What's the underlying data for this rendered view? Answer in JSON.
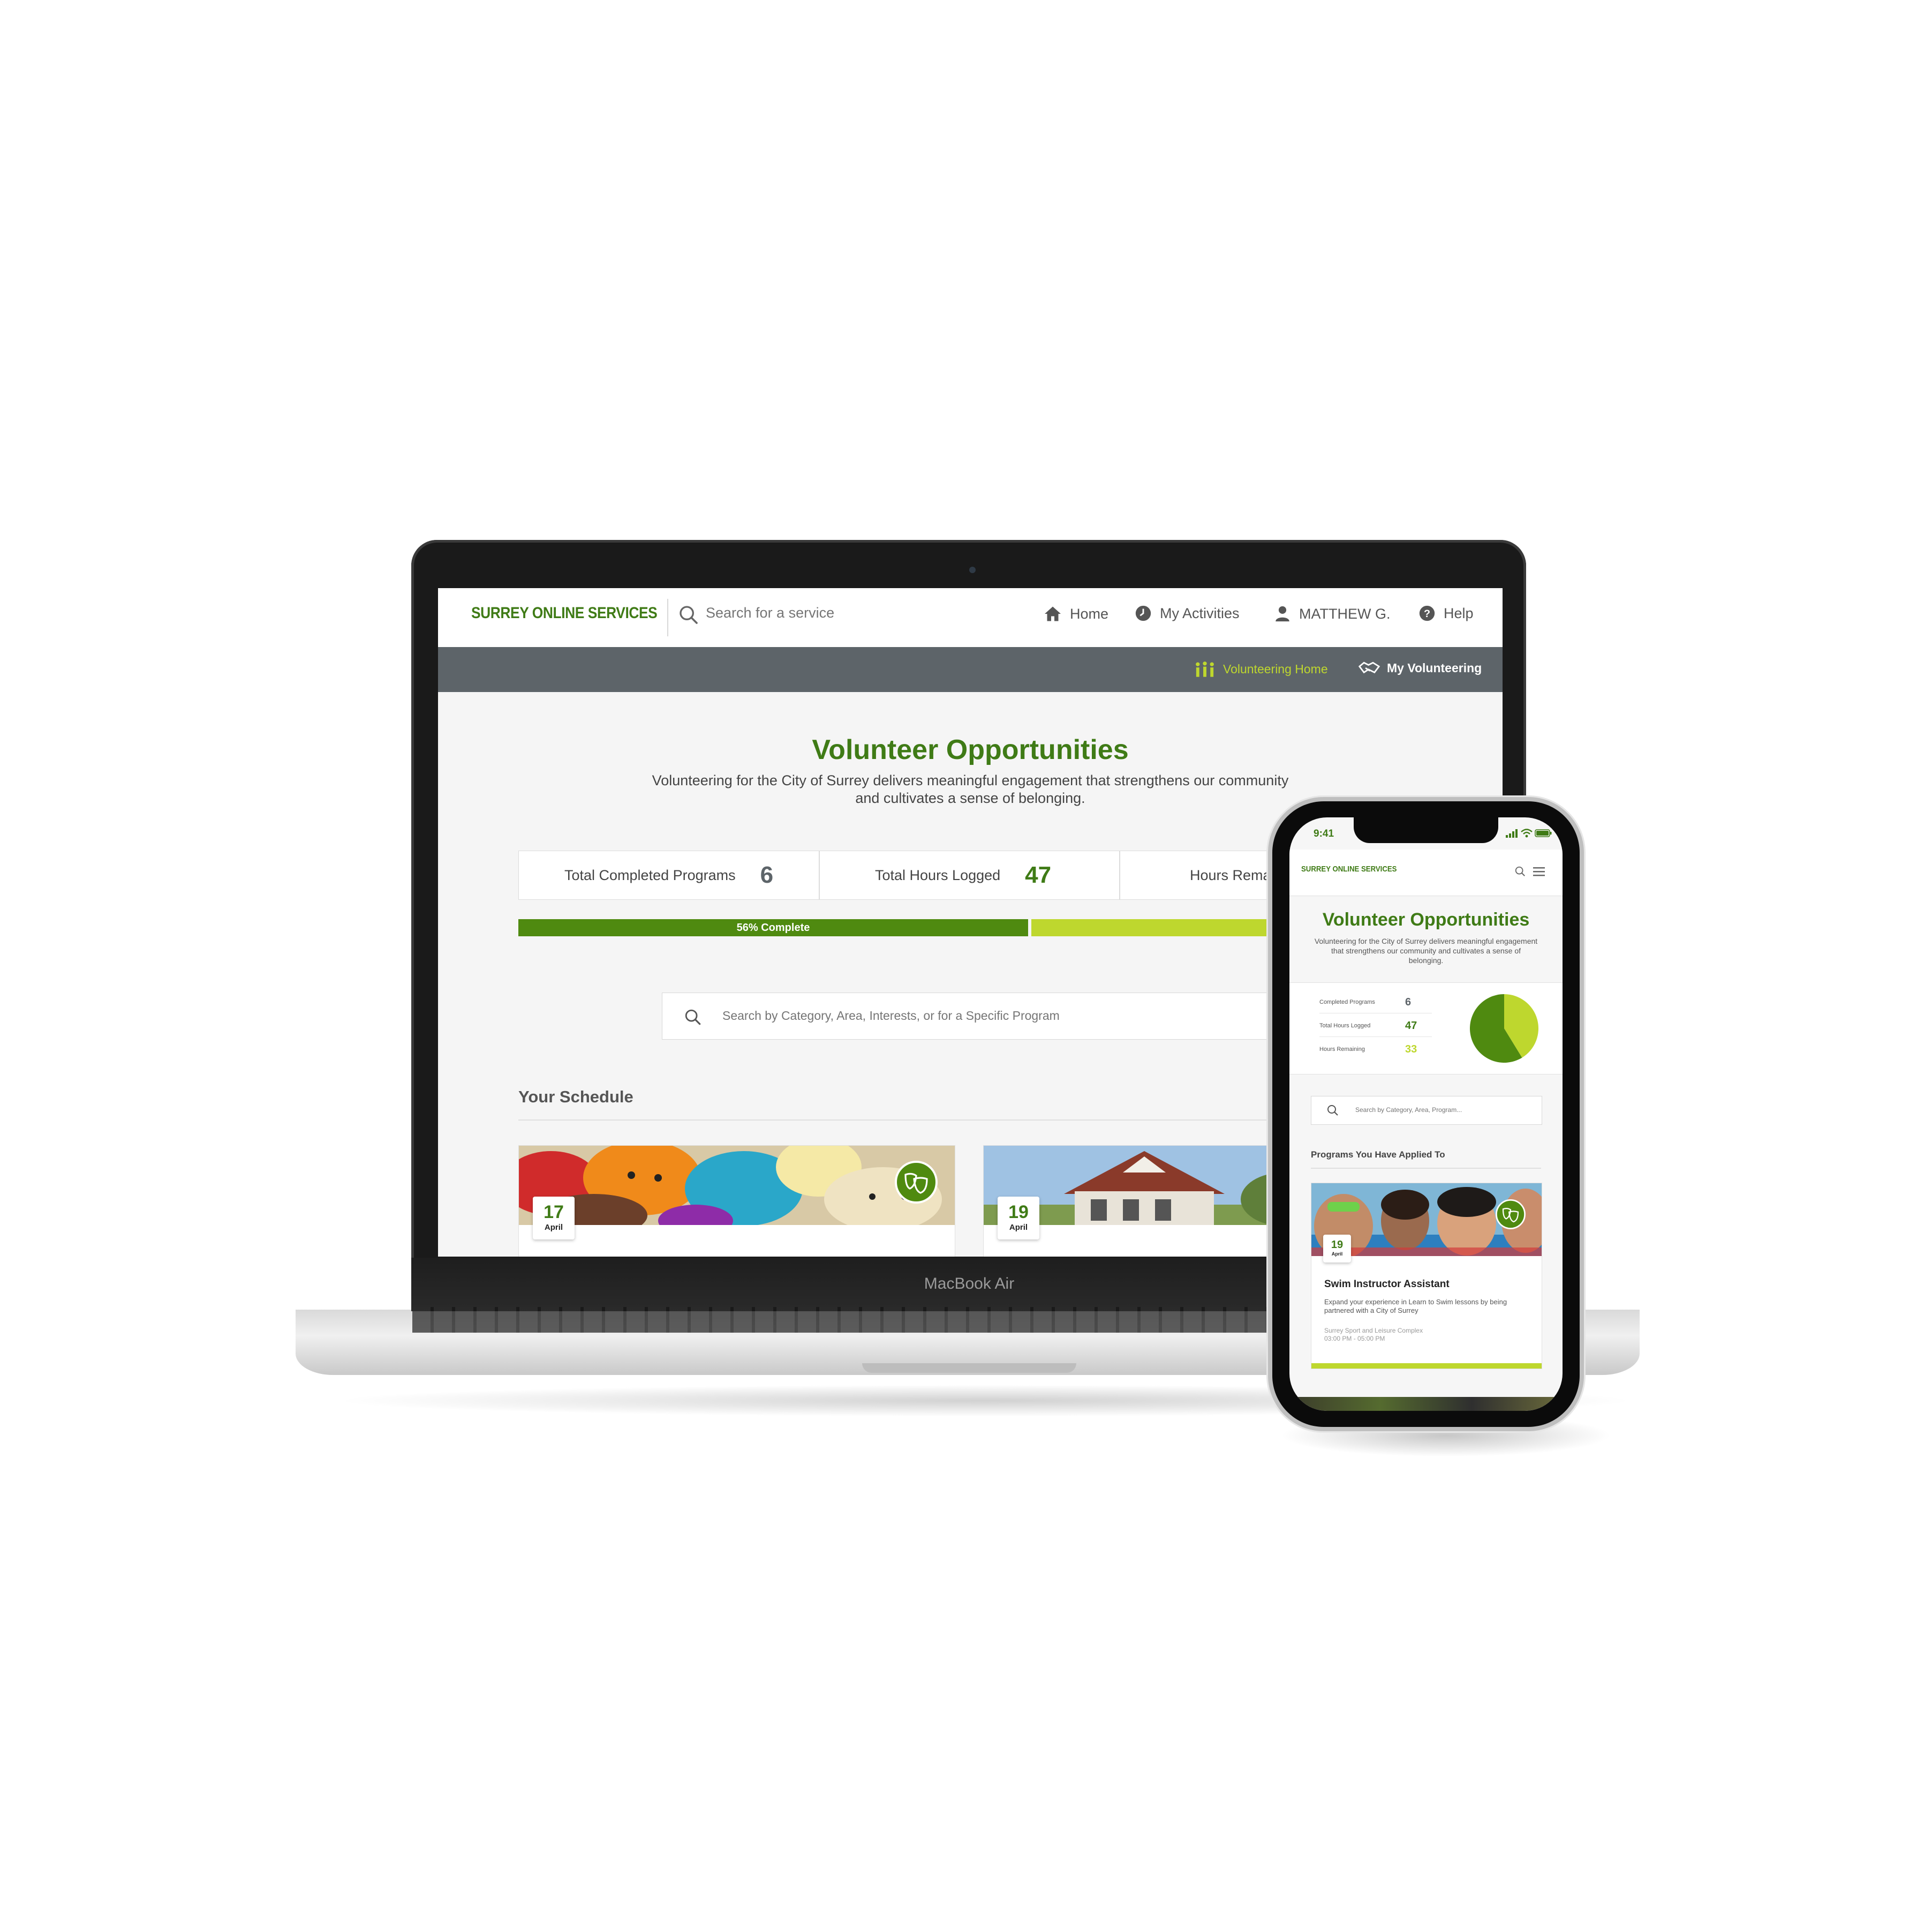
{
  "colors": {
    "brand_green": "#3f7b16",
    "lime": "#bed72e",
    "progress_dark": "#4f8a10",
    "subnav_bg": "#5d6469"
  },
  "desktop": {
    "logo": "SURREY ONLINE SERVICES",
    "search_placeholder": "Search for a service",
    "nav": [
      {
        "label": "Home",
        "icon": "home-icon"
      },
      {
        "label": "My Activities",
        "icon": "clock-icon"
      },
      {
        "label": "MATTHEW G.",
        "icon": "user-icon"
      },
      {
        "label": "Help",
        "icon": "help-icon"
      }
    ],
    "subnav": [
      {
        "label": "Volunteering Home",
        "icon": "volunteers-icon",
        "active": true
      },
      {
        "label": "My Volunteering",
        "icon": "handshake-icon",
        "active": false
      }
    ],
    "title": "Volunteer Opportunities",
    "intro": "Volunteering for the City of Surrey delivers meaningful engagement that strengthens our community and cultivates a sense of belonging.",
    "stats": [
      {
        "label": "Total Completed Programs",
        "value": "6"
      },
      {
        "label": "Total Hours Logged",
        "value": "47"
      },
      {
        "label": "Hours Remai",
        "value": ""
      }
    ],
    "progress": {
      "percent": 56,
      "label": "56% Complete"
    },
    "program_search_placeholder": "Search by Category, Area, Interests, or for a Specific Program",
    "schedule_title": "Your Schedule",
    "cards": [
      {
        "day": "17",
        "month": "April",
        "image": "knitted-toys",
        "category_icon": "theatre-masks-icon"
      },
      {
        "day": "19",
        "month": "April",
        "image": "historic-house",
        "category_icon": ""
      }
    ]
  },
  "laptop_brand": "MacBook Air",
  "phone": {
    "time": "9:41",
    "logo": "SURREY ONLINE SERVICES",
    "title": "Volunteer Opportunities",
    "intro": "Volunteering for the City of Surrey delivers meaningful engagement that strengthens our community and cultivates a sense of belonging.",
    "stats": [
      {
        "label": "Completed Programs",
        "value": "6"
      },
      {
        "label": "Total Hours Logged",
        "value": "47"
      },
      {
        "label": "Hours Remaining",
        "value": "33"
      }
    ],
    "pie": {
      "hours_logged": 47,
      "hours_remaining": 33
    },
    "search_placeholder": "Search by Category, Area, Program...",
    "section_title": "Programs You Have Applied To",
    "card": {
      "day": "19",
      "month": "April",
      "title": "Swim Instructor Assistant",
      "description": "Expand your experience in Learn to Swim lessons by being partnered with a City of Surrey",
      "location": "Surrey Sport and Leisure Complex",
      "time": "03:00 PM - 05:00 PM",
      "category_icon": "theatre-masks-icon"
    }
  }
}
